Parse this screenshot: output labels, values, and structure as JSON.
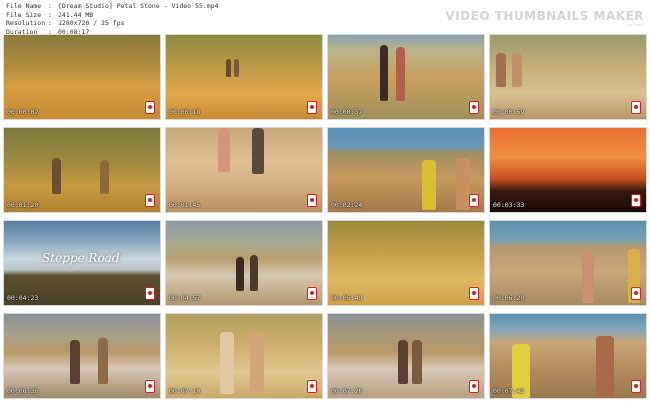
{
  "header": {
    "rows": [
      {
        "key": "File Name",
        "value": "[Dream Studio] Petal Stone - Video 55.mp4"
      },
      {
        "key": "File Size",
        "value": "241.44 MB"
      },
      {
        "key": "Resolution",
        "value": "1280x720 / 25 fps"
      },
      {
        "key": "Duration",
        "value": "00:08:17"
      }
    ]
  },
  "brand": {
    "title": "VIDEO THUMBNAILS MAKER",
    "subtitle": "by Scene"
  },
  "thumbnails": [
    {
      "time": "00:00:02",
      "scene": "field-sunset"
    },
    {
      "time": "00:00:18",
      "scene": "two-girls-far-field"
    },
    {
      "time": "00:00:37",
      "scene": "girls-walking-path"
    },
    {
      "time": "00:00:59",
      "scene": "girls-in-grass"
    },
    {
      "time": "00:01:20",
      "scene": "girls-field-evening"
    },
    {
      "time": "00:01:45",
      "scene": "legs-running"
    },
    {
      "time": "00:02:24",
      "scene": "girls-by-sea"
    },
    {
      "time": "00:03:33",
      "scene": "orange-sunset-silhouettes"
    },
    {
      "time": "00:04:23",
      "scene": "title-sky",
      "overlay": "Steppe Road"
    },
    {
      "time": "00:04:57",
      "scene": "road-two-girls"
    },
    {
      "time": "00:05:40",
      "scene": "yellow-field"
    },
    {
      "time": "00:06:20",
      "scene": "path-by-sea"
    },
    {
      "time": "00:06:36",
      "scene": "road-running"
    },
    {
      "time": "00:07:10",
      "scene": "girls-walking-grass"
    },
    {
      "time": "00:07:26",
      "scene": "girls-road-dust"
    },
    {
      "time": "00:07:42",
      "scene": "closeup-girls-sea"
    }
  ],
  "colors": {
    "timestamp": "#f2f2f2",
    "brand": "#d4d4d4"
  }
}
